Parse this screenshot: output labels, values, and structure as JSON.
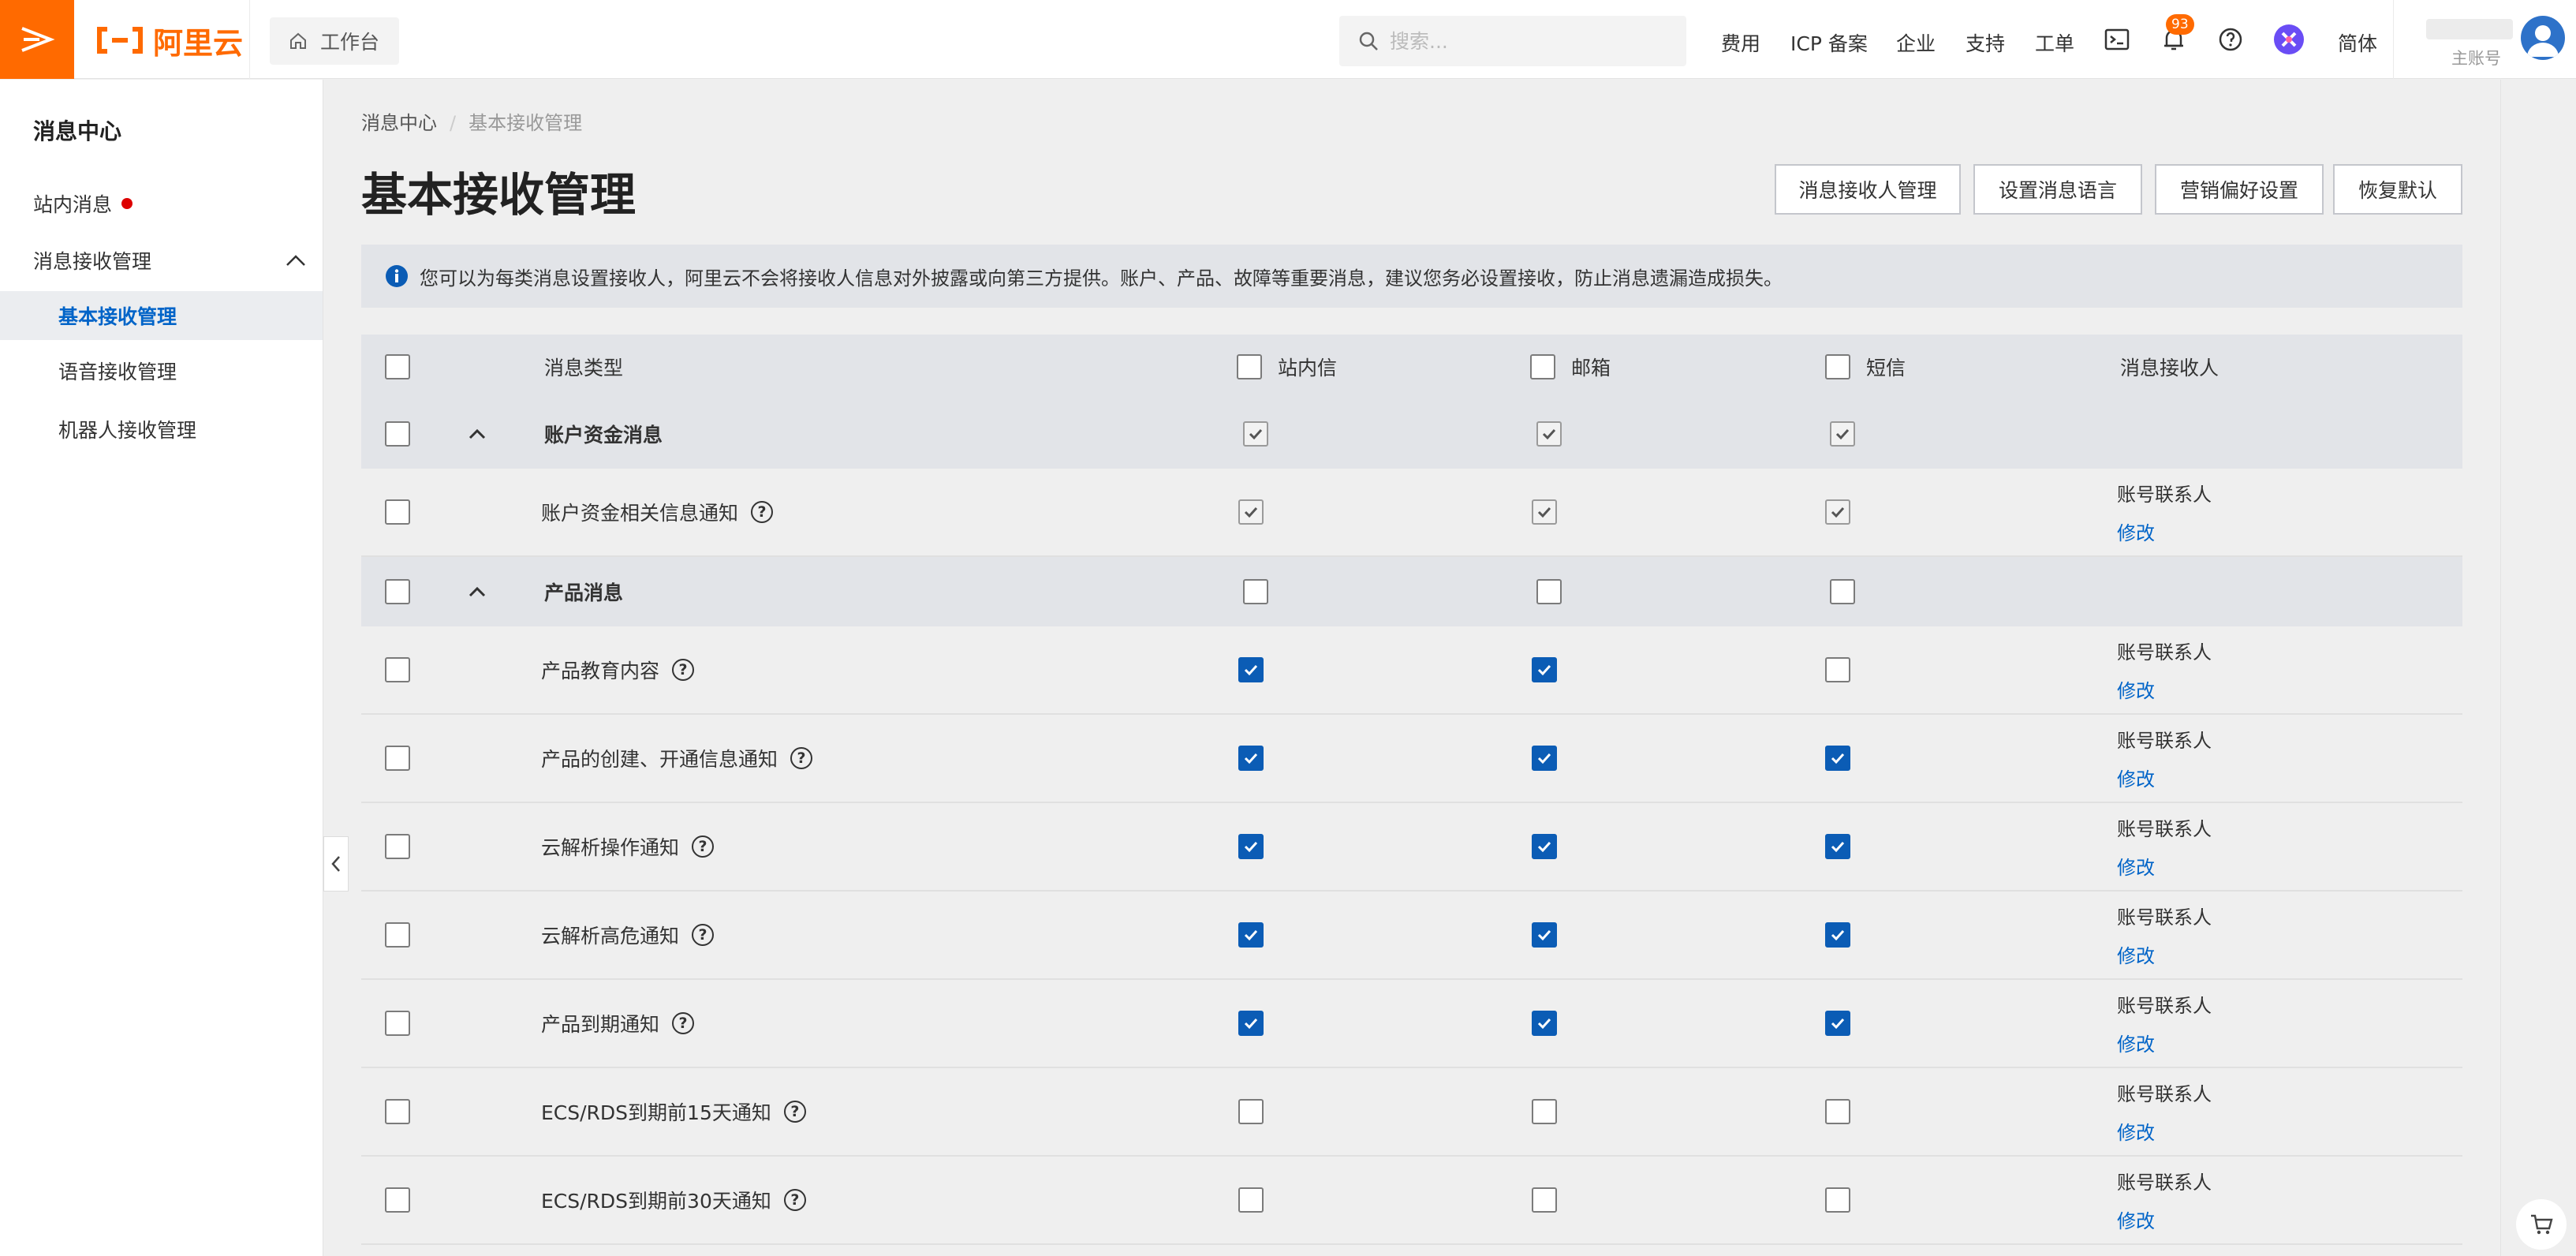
{
  "topbar": {
    "logo_text": "阿里云",
    "workbench_label": "工作台",
    "search_placeholder": "搜索...",
    "nav_links": [
      "费用",
      "ICP 备案",
      "企业",
      "支持",
      "工单"
    ],
    "notification_count": "93",
    "language": "简体",
    "account_label": "主账号",
    "accent_color": "#ff6a00"
  },
  "sidebar": {
    "title": "消息中心",
    "items": [
      {
        "label": "站内消息"
      },
      {
        "label": "消息接收管理"
      },
      {
        "label": "基本接收管理"
      },
      {
        "label": "语音接收管理"
      },
      {
        "label": "机器人接收管理"
      }
    ]
  },
  "main": {
    "breadcrumb": [
      "消息中心",
      "/",
      "基本接收管理"
    ],
    "title": "基本接收管理",
    "buttons": [
      "消息接收人管理",
      "设置消息语言",
      "营销偏好设置",
      "恢复默认"
    ],
    "notice": "您可以为每类消息设置接收人，阿里云不会将接收人信息对外披露或向第三方提供。账户、产品、故障等重要消息，建议您务必设置接收，防止消息遗漏造成损失。"
  },
  "table": {
    "headers": {
      "type": "消息类型",
      "site": "站内信",
      "mail": "邮箱",
      "sms": "短信",
      "receiver": "消息接收人"
    },
    "modify_label": "修改",
    "rows": [
      {
        "kind": "group",
        "name": "账户资金消息",
        "site": "disabled-checked",
        "mail": "disabled-checked",
        "sms": "disabled-checked"
      },
      {
        "kind": "item",
        "name": "账户资金相关信息通知",
        "site": "disabled-checked",
        "mail": "disabled-checked",
        "sms": "disabled-checked",
        "receiver": "账号联系人"
      },
      {
        "kind": "group",
        "name": "产品消息",
        "site": "unchecked",
        "mail": "unchecked",
        "sms": "unchecked"
      },
      {
        "kind": "item",
        "name": "产品教育内容",
        "site": "checked",
        "mail": "checked",
        "sms": "unchecked",
        "receiver": "账号联系人"
      },
      {
        "kind": "item",
        "name": "产品的创建、开通信息通知",
        "site": "checked",
        "mail": "checked",
        "sms": "checked",
        "receiver": "账号联系人"
      },
      {
        "kind": "item",
        "name": "云解析操作通知",
        "site": "checked",
        "mail": "checked",
        "sms": "checked",
        "receiver": "账号联系人"
      },
      {
        "kind": "item",
        "name": "云解析高危通知",
        "site": "checked",
        "mail": "checked",
        "sms": "checked",
        "receiver": "账号联系人"
      },
      {
        "kind": "item",
        "name": "产品到期通知",
        "site": "checked",
        "mail": "checked",
        "sms": "checked",
        "receiver": "账号联系人"
      },
      {
        "kind": "item",
        "name": "ECS/RDS到期前15天通知",
        "site": "unchecked",
        "mail": "unchecked",
        "sms": "unchecked",
        "receiver": "账号联系人"
      },
      {
        "kind": "item",
        "name": "ECS/RDS到期前30天通知",
        "site": "unchecked",
        "mail": "unchecked",
        "sms": "unchecked",
        "receiver": "账号联系人"
      }
    ]
  }
}
